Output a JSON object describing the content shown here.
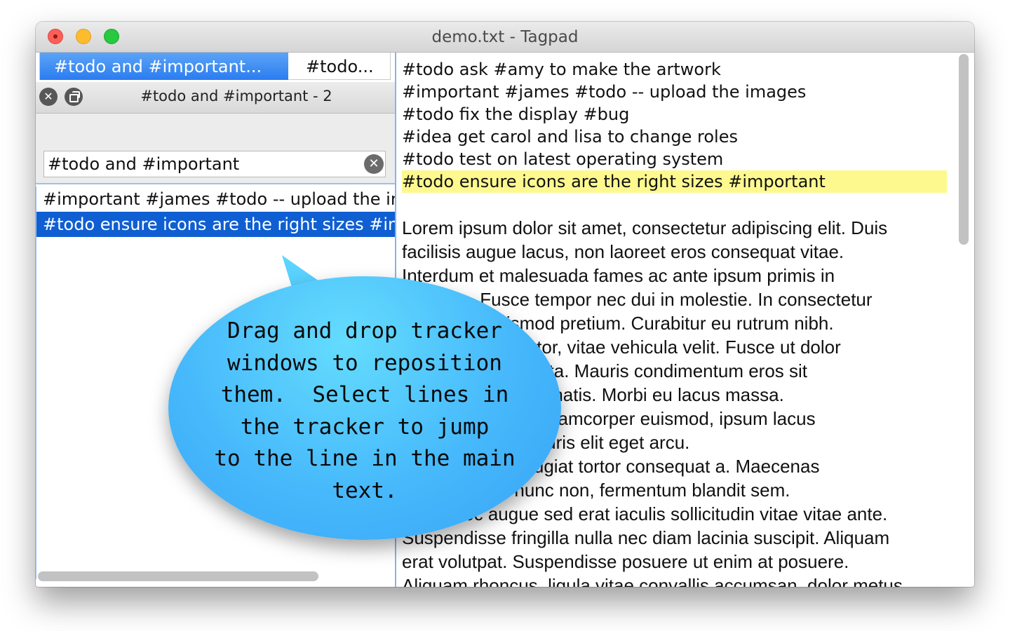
{
  "window": {
    "title": "demo.txt - Tagpad"
  },
  "tabs": [
    {
      "label": "#todo and #important..."
    },
    {
      "label": "#todo..."
    }
  ],
  "tracker": {
    "title": "#todo and #important - 2",
    "search_value": "#todo and #important",
    "results": [
      "#important #james #todo -- upload the images",
      "#todo ensure icons are the right sizes #important"
    ],
    "selected_index": 1
  },
  "editor": {
    "tag_lines": [
      "#todo ask #amy to make the artwork",
      "#important #james #todo -- upload the images",
      "#todo fix the display #bug",
      "#idea get carol and lisa to change roles",
      "#todo test on latest operating system",
      "#todo ensure icons are the right sizes #important"
    ],
    "highlighted_index": 5,
    "lorem_lines": [
      "Lorem ipsum dolor sit amet, consectetur adipiscing elit. Duis",
      "facilisis augue lacus, non laoreet eros consequat vitae.",
      "Interdum et malesuada fames ac ante ipsum primis in",
      "faucibus. Fusce tempor nec dui in molestie. In consectetur",
      "diam sem euismod pretium. Curabitur eu rutrum nibh.",
      "Sed interdum tortor, vitae vehicula velit. Fusce ut dolor",
      "vel vestibulum porta. Mauris condimentum eros sit",
      "amet semper venenatis. Morbi eu lacus massa.",
      "Donec mauris et ullamcorper euismod, ipsum lacus",
      "tempus varius mauris elit eget arcu.",
      "Cras odio, vel feugiat tortor consequat a. Maecenas",
      "nisi viverra ut nunc non, fermentum blandit sem.",
      "Etiam nec augue sed erat iaculis sollicitudin vitae vitae ante.",
      "Suspendisse fringilla nulla nec diam lacinia suscipit. Aliquam",
      "erat volutpat. Suspendisse posuere ut enim at posuere.",
      "Aliquam rhoncus, ligula vitae convallis accumsan, dolor metus"
    ]
  },
  "callout": {
    "lines": [
      "Drag and drop tracker",
      "windows to reposition",
      "them.  Select lines in",
      "the tracker to jump",
      "to the line in the main",
      "text."
    ]
  },
  "colors": {
    "accent": "#2a7cf0",
    "selection": "#0f5fd2",
    "highlight": "#fdf98f",
    "bubble": "#46b8fb"
  }
}
